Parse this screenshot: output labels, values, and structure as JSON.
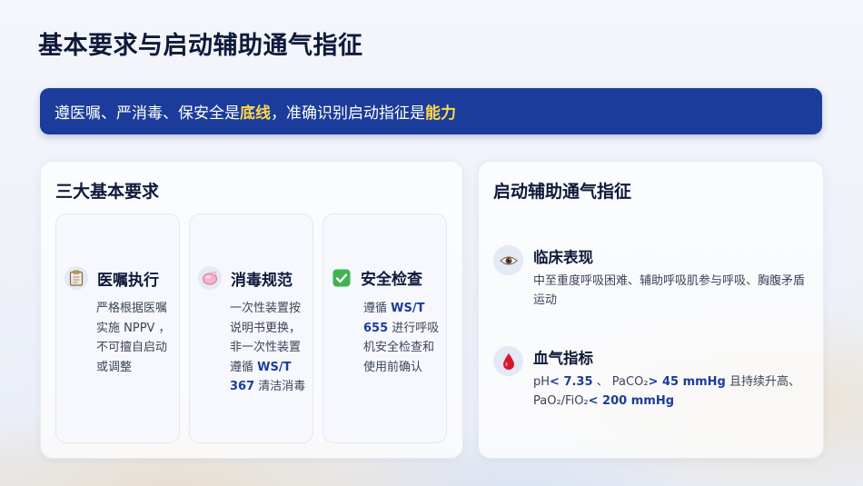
{
  "title": "基本要求与启动辅助通气指征",
  "banner": {
    "part1": "遵医嘱、严消毒、保安全是",
    "highlight1": "底线",
    "part2": "，准确识别启动指征是",
    "highlight2": "能力"
  },
  "requirements": {
    "heading": "三大基本要求",
    "cards": [
      {
        "icon": "clipboard-icon",
        "title": "医嘱执行",
        "desc": "严格根据医嘱实施 NPPV ，不可擅自启动或调整"
      },
      {
        "icon": "soap-icon",
        "title": "消毒规范",
        "desc_a": "一次性装置按说明书更换，非一次性装置遵循 ",
        "desc_b": "WS/T 367",
        "desc_c": " 清洁消毒"
      },
      {
        "icon": "check-box-icon",
        "title": "安全检查",
        "desc_a": "遵循 ",
        "desc_b": "WS/T 655",
        "desc_c": " 进行呼吸机安全检查和使用前确认"
      }
    ]
  },
  "indications": {
    "heading": "启动辅助通气指征",
    "clinical": {
      "icon": "eye-icon",
      "title": "临床表现",
      "desc": "中至重度呼吸困难、辅助呼吸肌参与呼吸、胸腹矛盾运动"
    },
    "blood_gas": {
      "icon": "blood-drop-icon",
      "title": "血气指标",
      "ph_label": "pH",
      "ph_value": "< 7.35",
      "sep1": " 、 PaCO₂",
      "paco2_value": "> 45 mmHg",
      "mid": " 且持续升高、 PaO₂/FiO₂",
      "ratio_value": "< 200 mmHg"
    }
  },
  "colors": {
    "primary": "#1b3c9a",
    "highlight": "#ffd84a",
    "title": "#0f1a3a"
  }
}
